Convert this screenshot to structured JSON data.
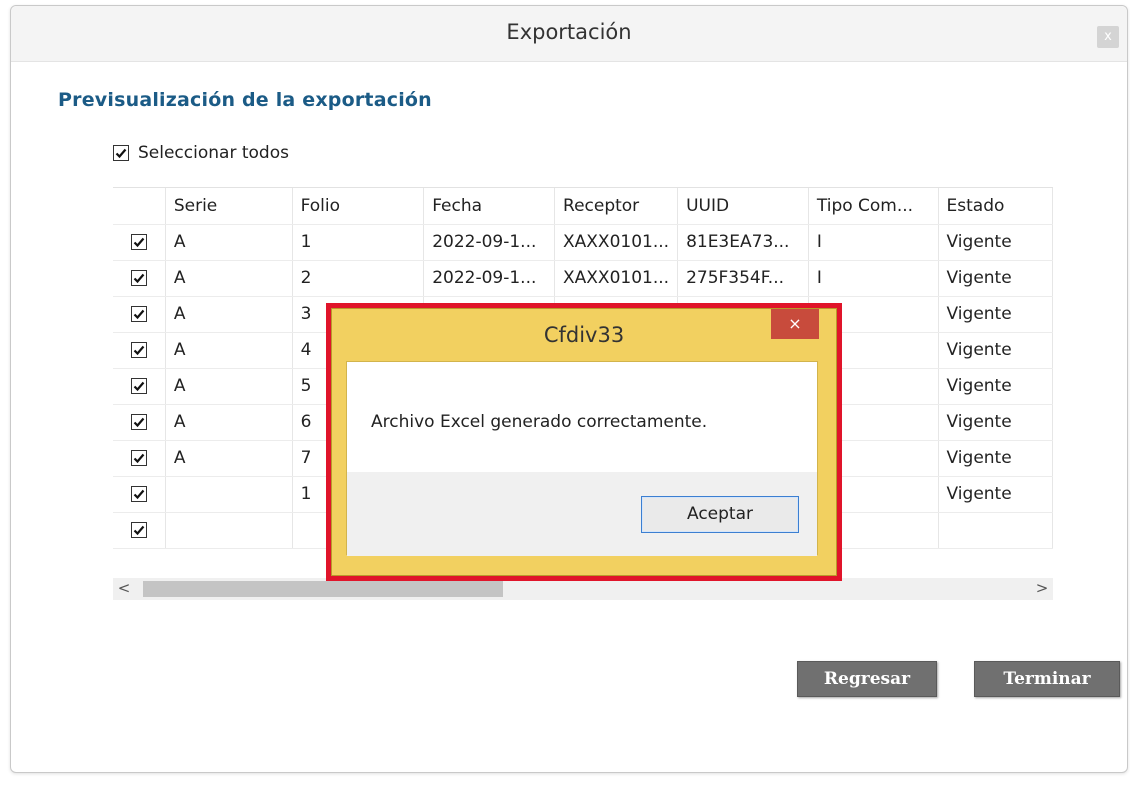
{
  "window": {
    "title": "Exportación",
    "close_label": "x"
  },
  "preview": {
    "heading": "Previsualización de la exportación",
    "select_all_label": "Seleccionar todos",
    "columns": [
      "Serie",
      "Folio",
      "Fecha",
      "Receptor",
      "UUID",
      "Tipo Com...",
      "Estado"
    ],
    "rows": [
      {
        "serie": "A",
        "folio": "1",
        "fecha": "2022-09-1...",
        "receptor": "XAXX0101...",
        "uuid": "81E3EA73...",
        "tipo": "I",
        "estado": "Vigente"
      },
      {
        "serie": "A",
        "folio": "2",
        "fecha": "2022-09-1...",
        "receptor": "XAXX0101...",
        "uuid": "275F354F...",
        "tipo": "I",
        "estado": "Vigente"
      },
      {
        "serie": "A",
        "folio": "3",
        "fecha": "",
        "receptor": "",
        "uuid": "",
        "tipo": "",
        "estado": "Vigente"
      },
      {
        "serie": "A",
        "folio": "4",
        "fecha": "",
        "receptor": "",
        "uuid": "",
        "tipo": "",
        "estado": "Vigente"
      },
      {
        "serie": "A",
        "folio": "5",
        "fecha": "",
        "receptor": "",
        "uuid": "",
        "tipo": "",
        "estado": "Vigente"
      },
      {
        "serie": "A",
        "folio": "6",
        "fecha": "",
        "receptor": "",
        "uuid": "",
        "tipo": "",
        "estado": "Vigente"
      },
      {
        "serie": "A",
        "folio": "7",
        "fecha": "",
        "receptor": "",
        "uuid": "",
        "tipo": "",
        "estado": "Vigente"
      },
      {
        "serie": "",
        "folio": "1",
        "fecha": "",
        "receptor": "",
        "uuid": "",
        "tipo": "",
        "estado": "Vigente"
      },
      {
        "serie": "",
        "folio": "",
        "fecha": "",
        "receptor": "",
        "uuid": "",
        "tipo": "",
        "estado": ""
      }
    ]
  },
  "scrollbar": {
    "left_arrow": "<",
    "right_arrow": ">"
  },
  "buttons": {
    "back": "Regresar",
    "finish": "Terminar"
  },
  "dialog": {
    "title": "Cfdiv33",
    "close_label": "×",
    "message": "Archivo Excel generado correctamente.",
    "ok_label": "Aceptar"
  },
  "colors": {
    "heading": "#1b5b86",
    "dialog_frame": "#f2d060",
    "highlight": "#e0142a",
    "button": "#707070"
  }
}
